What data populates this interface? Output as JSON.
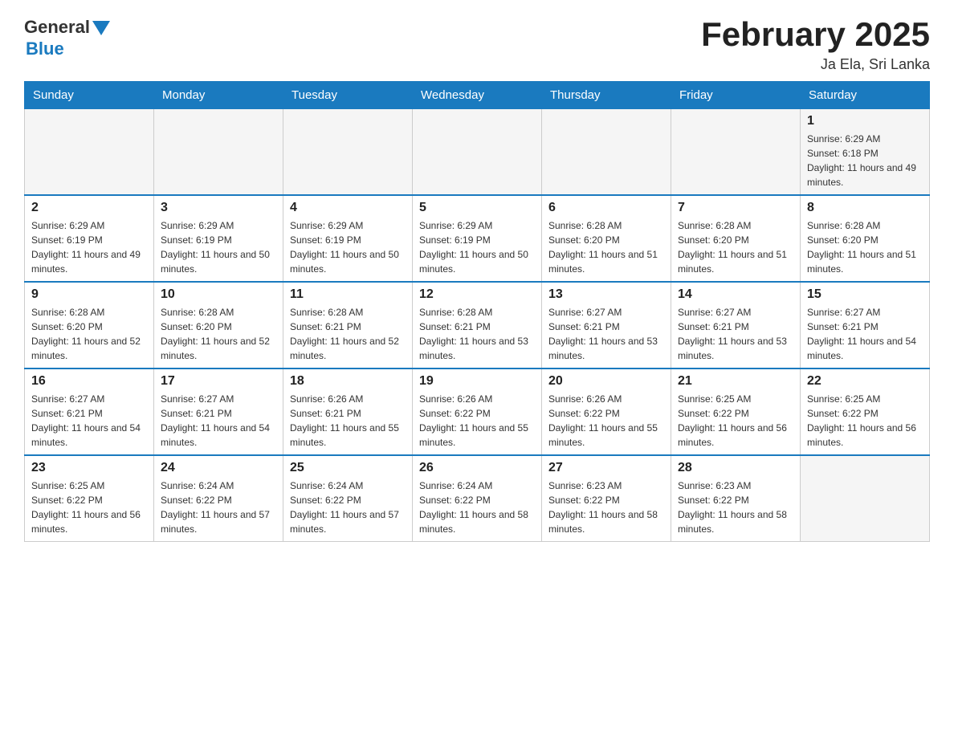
{
  "logo": {
    "general": "General",
    "blue": "Blue"
  },
  "header": {
    "title": "February 2025",
    "subtitle": "Ja Ela, Sri Lanka"
  },
  "days_of_week": [
    "Sunday",
    "Monday",
    "Tuesday",
    "Wednesday",
    "Thursday",
    "Friday",
    "Saturday"
  ],
  "weeks": [
    [
      {
        "day": "",
        "info": ""
      },
      {
        "day": "",
        "info": ""
      },
      {
        "day": "",
        "info": ""
      },
      {
        "day": "",
        "info": ""
      },
      {
        "day": "",
        "info": ""
      },
      {
        "day": "",
        "info": ""
      },
      {
        "day": "1",
        "info": "Sunrise: 6:29 AM\nSunset: 6:18 PM\nDaylight: 11 hours and 49 minutes."
      }
    ],
    [
      {
        "day": "2",
        "info": "Sunrise: 6:29 AM\nSunset: 6:19 PM\nDaylight: 11 hours and 49 minutes."
      },
      {
        "day": "3",
        "info": "Sunrise: 6:29 AM\nSunset: 6:19 PM\nDaylight: 11 hours and 50 minutes."
      },
      {
        "day": "4",
        "info": "Sunrise: 6:29 AM\nSunset: 6:19 PM\nDaylight: 11 hours and 50 minutes."
      },
      {
        "day": "5",
        "info": "Sunrise: 6:29 AM\nSunset: 6:19 PM\nDaylight: 11 hours and 50 minutes."
      },
      {
        "day": "6",
        "info": "Sunrise: 6:28 AM\nSunset: 6:20 PM\nDaylight: 11 hours and 51 minutes."
      },
      {
        "day": "7",
        "info": "Sunrise: 6:28 AM\nSunset: 6:20 PM\nDaylight: 11 hours and 51 minutes."
      },
      {
        "day": "8",
        "info": "Sunrise: 6:28 AM\nSunset: 6:20 PM\nDaylight: 11 hours and 51 minutes."
      }
    ],
    [
      {
        "day": "9",
        "info": "Sunrise: 6:28 AM\nSunset: 6:20 PM\nDaylight: 11 hours and 52 minutes."
      },
      {
        "day": "10",
        "info": "Sunrise: 6:28 AM\nSunset: 6:20 PM\nDaylight: 11 hours and 52 minutes."
      },
      {
        "day": "11",
        "info": "Sunrise: 6:28 AM\nSunset: 6:21 PM\nDaylight: 11 hours and 52 minutes."
      },
      {
        "day": "12",
        "info": "Sunrise: 6:28 AM\nSunset: 6:21 PM\nDaylight: 11 hours and 53 minutes."
      },
      {
        "day": "13",
        "info": "Sunrise: 6:27 AM\nSunset: 6:21 PM\nDaylight: 11 hours and 53 minutes."
      },
      {
        "day": "14",
        "info": "Sunrise: 6:27 AM\nSunset: 6:21 PM\nDaylight: 11 hours and 53 minutes."
      },
      {
        "day": "15",
        "info": "Sunrise: 6:27 AM\nSunset: 6:21 PM\nDaylight: 11 hours and 54 minutes."
      }
    ],
    [
      {
        "day": "16",
        "info": "Sunrise: 6:27 AM\nSunset: 6:21 PM\nDaylight: 11 hours and 54 minutes."
      },
      {
        "day": "17",
        "info": "Sunrise: 6:27 AM\nSunset: 6:21 PM\nDaylight: 11 hours and 54 minutes."
      },
      {
        "day": "18",
        "info": "Sunrise: 6:26 AM\nSunset: 6:21 PM\nDaylight: 11 hours and 55 minutes."
      },
      {
        "day": "19",
        "info": "Sunrise: 6:26 AM\nSunset: 6:22 PM\nDaylight: 11 hours and 55 minutes."
      },
      {
        "day": "20",
        "info": "Sunrise: 6:26 AM\nSunset: 6:22 PM\nDaylight: 11 hours and 55 minutes."
      },
      {
        "day": "21",
        "info": "Sunrise: 6:25 AM\nSunset: 6:22 PM\nDaylight: 11 hours and 56 minutes."
      },
      {
        "day": "22",
        "info": "Sunrise: 6:25 AM\nSunset: 6:22 PM\nDaylight: 11 hours and 56 minutes."
      }
    ],
    [
      {
        "day": "23",
        "info": "Sunrise: 6:25 AM\nSunset: 6:22 PM\nDaylight: 11 hours and 56 minutes."
      },
      {
        "day": "24",
        "info": "Sunrise: 6:24 AM\nSunset: 6:22 PM\nDaylight: 11 hours and 57 minutes."
      },
      {
        "day": "25",
        "info": "Sunrise: 6:24 AM\nSunset: 6:22 PM\nDaylight: 11 hours and 57 minutes."
      },
      {
        "day": "26",
        "info": "Sunrise: 6:24 AM\nSunset: 6:22 PM\nDaylight: 11 hours and 58 minutes."
      },
      {
        "day": "27",
        "info": "Sunrise: 6:23 AM\nSunset: 6:22 PM\nDaylight: 11 hours and 58 minutes."
      },
      {
        "day": "28",
        "info": "Sunrise: 6:23 AM\nSunset: 6:22 PM\nDaylight: 11 hours and 58 minutes."
      },
      {
        "day": "",
        "info": ""
      }
    ]
  ]
}
